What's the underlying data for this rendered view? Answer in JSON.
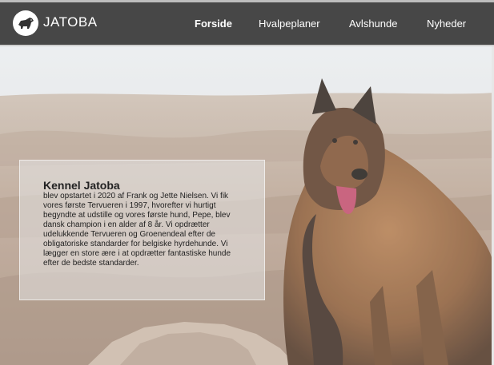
{
  "brand": {
    "name": "JATOBA",
    "logo_icon": "dog-logo-icon"
  },
  "nav": {
    "items": [
      {
        "label": "Forside",
        "active": true
      },
      {
        "label": "Hvalpeplaner",
        "active": false
      },
      {
        "label": "Avlshunde",
        "active": false
      },
      {
        "label": "Nyheder",
        "active": false
      }
    ]
  },
  "hero": {
    "title": "Kennel Jatoba",
    "text": "blev opstartet i 2020 af Frank og Jette Nielsen. Vi fik vores første Tervueren i 1997, hvorefter vi hurtigt begyndte at udstille og vores første hund, Pepe, blev dansk champion i en alder af 8 år. Vi opdrætter udelukkende Tervueren og Groenendeal efter de obligatoriske standarder for belgiske hyrdehunde. Vi lægger en store ære i at opdrætter fantastiske hunde efter de bedste standarder."
  },
  "colors": {
    "navbar": "#474747",
    "text_light": "#ffffff",
    "text_dark": "#222222"
  }
}
